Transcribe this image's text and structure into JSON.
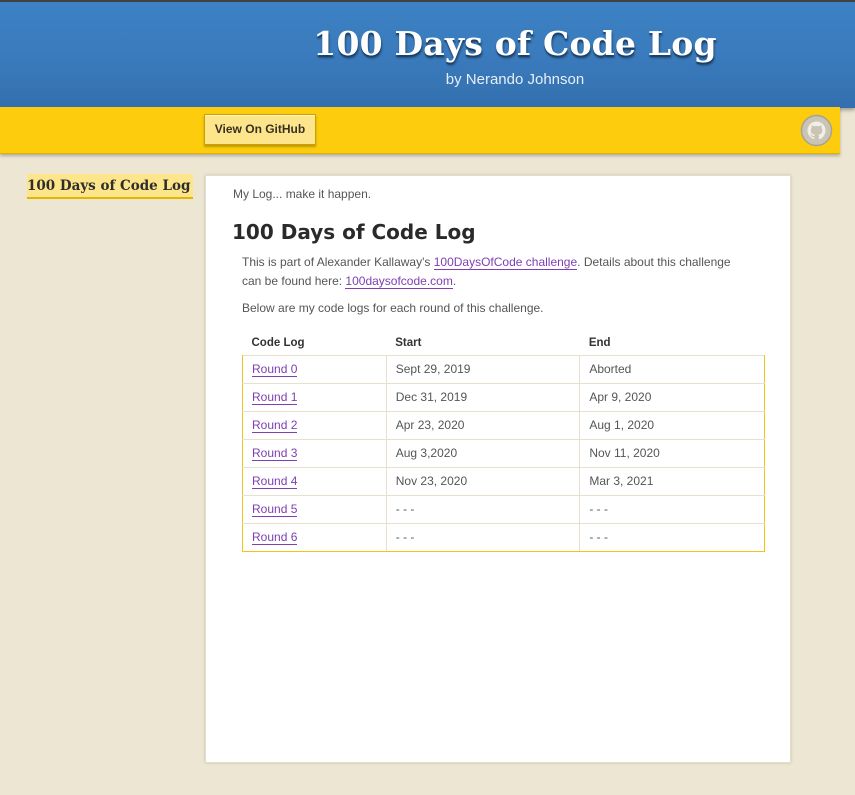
{
  "header": {
    "title": "100 Days of Code Log",
    "byline": "by Nerando Johnson"
  },
  "navbar": {
    "github_button": "View On GitHub",
    "github_icon": "octocat-icon"
  },
  "sidebar": {
    "items": [
      {
        "label": "100 Days of Code Log"
      }
    ]
  },
  "main": {
    "tagline": "My Log... make it happen.",
    "heading": "100 Days of Code Log",
    "intro": {
      "prefix": "This is part of Alexander Kallaway's ",
      "challenge_link": "100DaysOfCode challenge",
      "middle": ". Details about this challenge can be found here: ",
      "site_link": "100daysofcode.com",
      "suffix": "."
    },
    "below_text": "Below are my code logs for each round of this challenge.",
    "table": {
      "headers": [
        "Code Log",
        "Start",
        "End"
      ],
      "rows": [
        {
          "round": "Round 0",
          "start": "Sept 29, 2019",
          "end": "Aborted"
        },
        {
          "round": "Round 1",
          "start": "Dec 31, 2019",
          "end": "Apr 9, 2020"
        },
        {
          "round": "Round 2",
          "start": "Apr 23, 2020",
          "end": "Aug 1, 2020"
        },
        {
          "round": "Round 3",
          "start": "Aug 3,2020",
          "end": "Nov 11, 2020"
        },
        {
          "round": "Round 4",
          "start": "Nov 23, 2020",
          "end": "Mar 3, 2021"
        },
        {
          "round": "Round 5",
          "start": "- - -",
          "end": "- - -"
        },
        {
          "round": "Round 6",
          "start": "- - -",
          "end": "- - -"
        }
      ]
    }
  },
  "colors": {
    "header_blue": "#3a7bbd",
    "nav_yellow": "#fdcc0d",
    "link_purple": "#7d3fb1",
    "page_bg": "#ece6d3"
  }
}
